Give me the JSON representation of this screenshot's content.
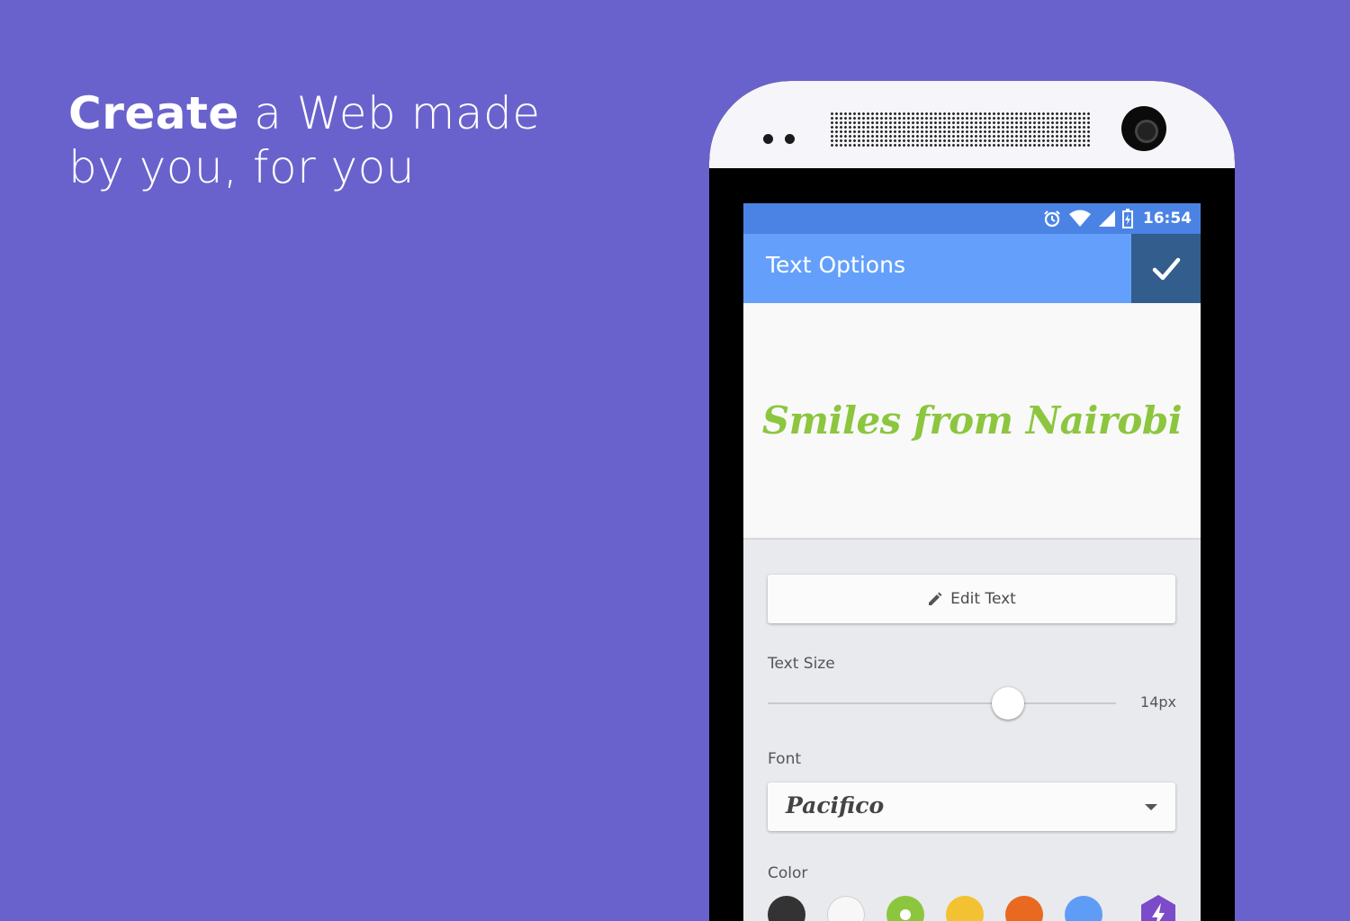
{
  "headline": {
    "bold": "Create",
    "rest_line1": " a Web made",
    "line2": "by you, for you"
  },
  "status_bar": {
    "icons": [
      "alarm-icon",
      "wifi-icon",
      "signal-icon",
      "battery-icon"
    ],
    "time": "16:54"
  },
  "app_bar": {
    "title": "Text Options",
    "confirm_icon": "check-icon"
  },
  "preview": {
    "text": "Smiles from Nairobi",
    "color": "#8cc63f"
  },
  "edit_button": {
    "icon": "pencil-icon",
    "label": "Edit Text"
  },
  "text_size": {
    "label": "Text Size",
    "value": "14px",
    "slider_fraction": 0.69
  },
  "font": {
    "label": "Font",
    "value": "Pacifico"
  },
  "color": {
    "label": "Color",
    "swatches": [
      "#333333",
      "#f7f7f7",
      "#8cc63f",
      "#f2c232",
      "#e8691f",
      "#5f9cf6"
    ],
    "selected": "#8cc63f",
    "custom_icon": "lightning-icon",
    "custom_color": "#7b4bc9"
  }
}
